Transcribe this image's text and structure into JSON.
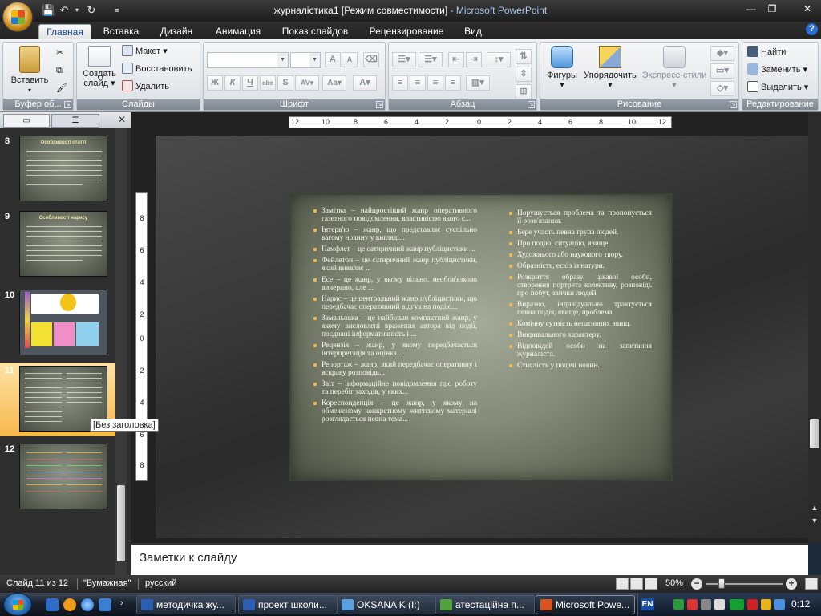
{
  "window": {
    "doc_title": "журналістика1 [Режим совместимости]",
    "app_title": " - Microsoft PowerPoint"
  },
  "ribbon": {
    "tabs": [
      "Главная",
      "Вставка",
      "Дизайн",
      "Анимация",
      "Показ слайдов",
      "Рецензирование",
      "Вид"
    ],
    "groups": {
      "clipboard": {
        "label": "Буфер об...",
        "paste": "Вставить"
      },
      "slides": {
        "label": "Слайды",
        "new_slide_1": "Создать",
        "new_slide_2": "слайд",
        "layout": "Макет",
        "reset": "Восстановить",
        "delete": "Удалить"
      },
      "font": {
        "label": "Шрифт"
      },
      "paragraph": {
        "label": "Абзац"
      },
      "drawing": {
        "label": "Рисование",
        "shapes": "Фигуры",
        "arrange": "Упорядочить",
        "quick_styles": "Экспресс-стили"
      },
      "editing": {
        "label": "Редактирование",
        "find": "Найти",
        "replace": "Заменить",
        "select": "Выделить"
      }
    }
  },
  "slides_panel": {
    "thumbnails": [
      {
        "number": "8",
        "title": "Особливості статті"
      },
      {
        "number": "9",
        "title": "Особливості нарису"
      },
      {
        "number": "10",
        "title": ""
      },
      {
        "number": "11",
        "title": ""
      },
      {
        "number": "12",
        "title": ""
      }
    ],
    "tooltip": "[Без заголовка]"
  },
  "ruler": {
    "h_labels": [
      "12",
      "10",
      "8",
      "6",
      "4",
      "2",
      "0",
      "2",
      "4",
      "6",
      "8",
      "10",
      "12"
    ],
    "v_labels": [
      "8",
      "6",
      "4",
      "2",
      "0",
      "2",
      "4",
      "6",
      "8"
    ]
  },
  "slide": {
    "left_items": [
      "Замітка – найпростіший жанр оперативного газетного повідомлення, властивістю якого є...",
      "Інтерв'ю – жанр, що представляє суспільно вагому новину у вигляді...",
      "Памфлет – це сатиричний жанр публіцистики ...",
      "Фейлетон – це сатиричний жанр публіцистики, який виявляє ...",
      "Есе – це жанр, у якому вільно, необов'язково вичерпно, але ...",
      "Нарис – це центральний жанр публіцистики, що передбачає оперативний відгук на подію...",
      "Замальовка – це найбільш компактний жанр, у якому висловлені враження автора від події, поєднані інформативність і ...",
      "Рецензія – жанр, у якому передбачається інтерпретація та оцінка...",
      "Репортаж – жанр, який передбачає оперативну і яскраву розповідь...",
      "Звіт – інформаційне повідомлення про роботу та перебіг заходів, у яких...",
      "Кореспонденція – це жанр, у якому на обмеженому конкретному життєвому матеріалі розглядається певна тема..."
    ],
    "right_items": [
      "Порушується проблема та пропонується її розв'язання.",
      "Бере участь певна група людей.",
      "Про подію, ситуацію, явище.",
      "Художнього або наукового твору.",
      "Образність, ескіз із натури.",
      "Розкриття образу цікавої особи, створення портрета колективу, розповідь про побут, звички людей",
      "Виразно, індивідуально трактується певна подія, явище, проблема.",
      "Комічну сутність негативних явищ.",
      "Викривального характеру.",
      "Відповідей особи на запитання журналіста.",
      "Стислість у подачі новин."
    ]
  },
  "notes": {
    "placeholder": "Заметки к слайду"
  },
  "status": {
    "slide_info": "Слайд 11 из 12",
    "theme": "\"Бумажная\"",
    "language": "русский",
    "zoom": "50%"
  },
  "taskbar": {
    "tasks": [
      "методичка жу...",
      "проект школи...",
      "OKSANA K (I:)",
      "атестаційна п...",
      "Microsoft Powe..."
    ],
    "lang": "EN",
    "clock": "0:12"
  }
}
